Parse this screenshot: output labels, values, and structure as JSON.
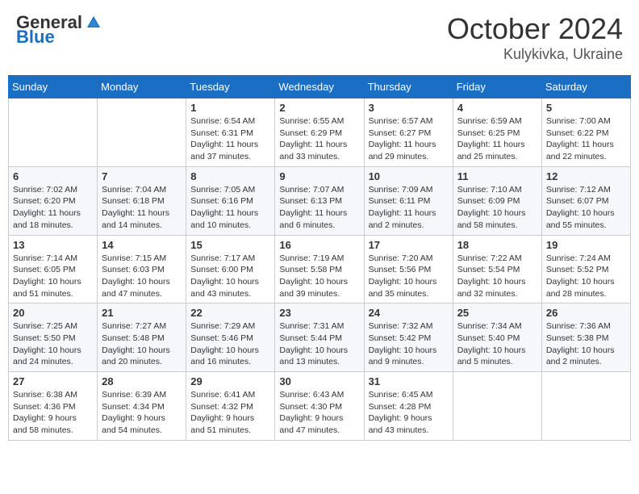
{
  "header": {
    "logo_general": "General",
    "logo_blue": "Blue",
    "month": "October 2024",
    "location": "Kulykivka, Ukraine"
  },
  "days_of_week": [
    "Sunday",
    "Monday",
    "Tuesday",
    "Wednesday",
    "Thursday",
    "Friday",
    "Saturday"
  ],
  "weeks": [
    [
      {
        "day": "",
        "info": ""
      },
      {
        "day": "",
        "info": ""
      },
      {
        "day": "1",
        "info": "Sunrise: 6:54 AM\nSunset: 6:31 PM\nDaylight: 11 hours and 37 minutes."
      },
      {
        "day": "2",
        "info": "Sunrise: 6:55 AM\nSunset: 6:29 PM\nDaylight: 11 hours and 33 minutes."
      },
      {
        "day": "3",
        "info": "Sunrise: 6:57 AM\nSunset: 6:27 PM\nDaylight: 11 hours and 29 minutes."
      },
      {
        "day": "4",
        "info": "Sunrise: 6:59 AM\nSunset: 6:25 PM\nDaylight: 11 hours and 25 minutes."
      },
      {
        "day": "5",
        "info": "Sunrise: 7:00 AM\nSunset: 6:22 PM\nDaylight: 11 hours and 22 minutes."
      }
    ],
    [
      {
        "day": "6",
        "info": "Sunrise: 7:02 AM\nSunset: 6:20 PM\nDaylight: 11 hours and 18 minutes."
      },
      {
        "day": "7",
        "info": "Sunrise: 7:04 AM\nSunset: 6:18 PM\nDaylight: 11 hours and 14 minutes."
      },
      {
        "day": "8",
        "info": "Sunrise: 7:05 AM\nSunset: 6:16 PM\nDaylight: 11 hours and 10 minutes."
      },
      {
        "day": "9",
        "info": "Sunrise: 7:07 AM\nSunset: 6:13 PM\nDaylight: 11 hours and 6 minutes."
      },
      {
        "day": "10",
        "info": "Sunrise: 7:09 AM\nSunset: 6:11 PM\nDaylight: 11 hours and 2 minutes."
      },
      {
        "day": "11",
        "info": "Sunrise: 7:10 AM\nSunset: 6:09 PM\nDaylight: 10 hours and 58 minutes."
      },
      {
        "day": "12",
        "info": "Sunrise: 7:12 AM\nSunset: 6:07 PM\nDaylight: 10 hours and 55 minutes."
      }
    ],
    [
      {
        "day": "13",
        "info": "Sunrise: 7:14 AM\nSunset: 6:05 PM\nDaylight: 10 hours and 51 minutes."
      },
      {
        "day": "14",
        "info": "Sunrise: 7:15 AM\nSunset: 6:03 PM\nDaylight: 10 hours and 47 minutes."
      },
      {
        "day": "15",
        "info": "Sunrise: 7:17 AM\nSunset: 6:00 PM\nDaylight: 10 hours and 43 minutes."
      },
      {
        "day": "16",
        "info": "Sunrise: 7:19 AM\nSunset: 5:58 PM\nDaylight: 10 hours and 39 minutes."
      },
      {
        "day": "17",
        "info": "Sunrise: 7:20 AM\nSunset: 5:56 PM\nDaylight: 10 hours and 35 minutes."
      },
      {
        "day": "18",
        "info": "Sunrise: 7:22 AM\nSunset: 5:54 PM\nDaylight: 10 hours and 32 minutes."
      },
      {
        "day": "19",
        "info": "Sunrise: 7:24 AM\nSunset: 5:52 PM\nDaylight: 10 hours and 28 minutes."
      }
    ],
    [
      {
        "day": "20",
        "info": "Sunrise: 7:25 AM\nSunset: 5:50 PM\nDaylight: 10 hours and 24 minutes."
      },
      {
        "day": "21",
        "info": "Sunrise: 7:27 AM\nSunset: 5:48 PM\nDaylight: 10 hours and 20 minutes."
      },
      {
        "day": "22",
        "info": "Sunrise: 7:29 AM\nSunset: 5:46 PM\nDaylight: 10 hours and 16 minutes."
      },
      {
        "day": "23",
        "info": "Sunrise: 7:31 AM\nSunset: 5:44 PM\nDaylight: 10 hours and 13 minutes."
      },
      {
        "day": "24",
        "info": "Sunrise: 7:32 AM\nSunset: 5:42 PM\nDaylight: 10 hours and 9 minutes."
      },
      {
        "day": "25",
        "info": "Sunrise: 7:34 AM\nSunset: 5:40 PM\nDaylight: 10 hours and 5 minutes."
      },
      {
        "day": "26",
        "info": "Sunrise: 7:36 AM\nSunset: 5:38 PM\nDaylight: 10 hours and 2 minutes."
      }
    ],
    [
      {
        "day": "27",
        "info": "Sunrise: 6:38 AM\nSunset: 4:36 PM\nDaylight: 9 hours and 58 minutes."
      },
      {
        "day": "28",
        "info": "Sunrise: 6:39 AM\nSunset: 4:34 PM\nDaylight: 9 hours and 54 minutes."
      },
      {
        "day": "29",
        "info": "Sunrise: 6:41 AM\nSunset: 4:32 PM\nDaylight: 9 hours and 51 minutes."
      },
      {
        "day": "30",
        "info": "Sunrise: 6:43 AM\nSunset: 4:30 PM\nDaylight: 9 hours and 47 minutes."
      },
      {
        "day": "31",
        "info": "Sunrise: 6:45 AM\nSunset: 4:28 PM\nDaylight: 9 hours and 43 minutes."
      },
      {
        "day": "",
        "info": ""
      },
      {
        "day": "",
        "info": ""
      }
    ]
  ]
}
